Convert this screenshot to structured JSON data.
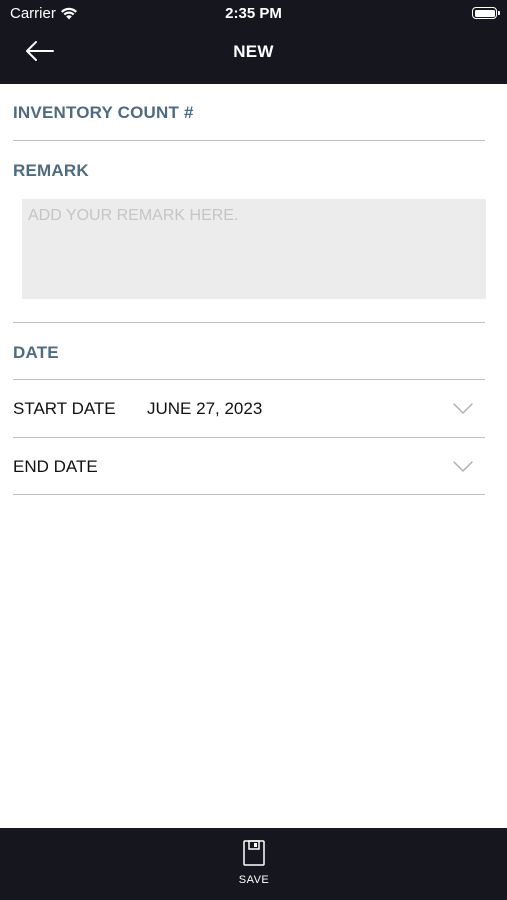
{
  "status_bar": {
    "carrier": "Carrier",
    "time": "2:35 PM"
  },
  "nav": {
    "title": "NEW",
    "back_icon": "arrow-left-icon"
  },
  "form": {
    "inventory_count_label": "INVENTORY COUNT #",
    "remark_label": "REMARK",
    "remark_placeholder": "ADD YOUR REMARK HERE.",
    "remark_value": "",
    "date_label": "DATE",
    "start_date": {
      "label": "START DATE",
      "value": "JUNE 27, 2023"
    },
    "end_date": {
      "label": "END DATE",
      "value": ""
    }
  },
  "toolbar": {
    "save_label": "SAVE",
    "save_icon": "floppy-disk-icon"
  },
  "colors": {
    "header_bg": "#16161f",
    "section_label": "#4e6b80",
    "remark_bg": "#ececec",
    "divider": "#bfbfbf"
  }
}
